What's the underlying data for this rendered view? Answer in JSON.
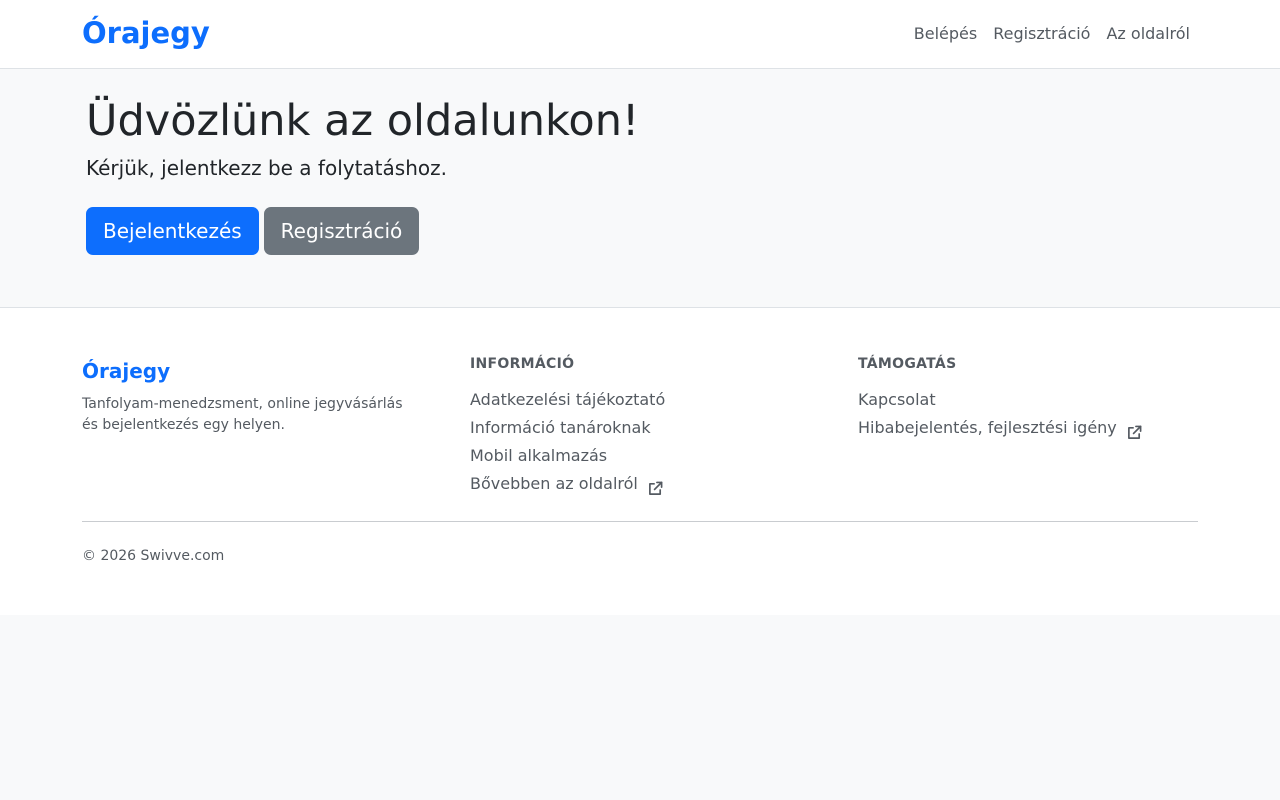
{
  "navbar": {
    "brand": "Órajegy",
    "links": [
      "Belépés",
      "Regisztráció",
      "Az oldalról"
    ]
  },
  "hero": {
    "title": "Üdvözlünk az oldalunkon!",
    "lead": "Kérjük, jelentkezz be a folytatáshoz.",
    "primary_button": "Bejelentkezés",
    "secondary_button": "Regisztráció"
  },
  "footer": {
    "brand": "Órajegy",
    "description": "Tanfolyam-menedzsment, online jegyvásárlás és bejelentkezés egy helyen.",
    "info": {
      "heading": "INFORMÁCIÓ",
      "links": [
        {
          "label": "Adatkezelési tájékoztató",
          "external": false
        },
        {
          "label": "Információ tanároknak",
          "external": false
        },
        {
          "label": "Mobil alkalmazás",
          "external": false
        },
        {
          "label": "Bővebben az oldalról",
          "external": true
        }
      ]
    },
    "support": {
      "heading": "TÁMOGATÁS",
      "links": [
        {
          "label": "Kapcsolat",
          "external": false
        },
        {
          "label": "Hibabejelentés, fejlesztési igény",
          "external": true
        }
      ]
    },
    "copyright": "© 2026 Swivve.com"
  },
  "colors": {
    "brand": "#0d6efd",
    "secondary": "#6c757d",
    "muted_text": "#545a61",
    "background": "#f8f9fa"
  }
}
